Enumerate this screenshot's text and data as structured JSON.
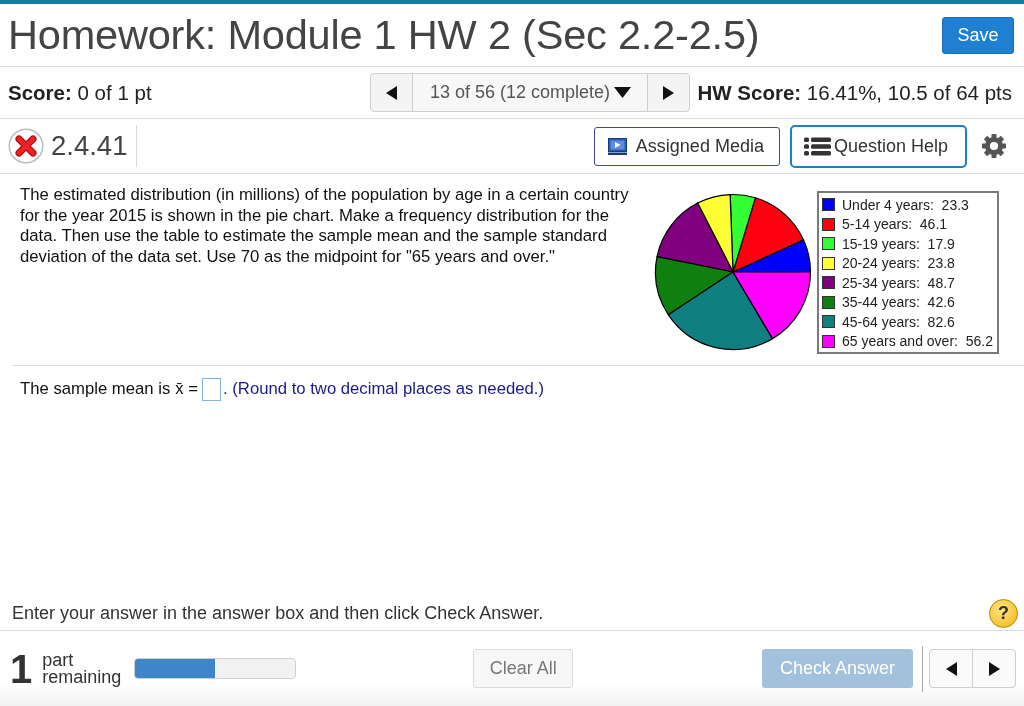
{
  "header": {
    "title": "Homework: Module 1 HW 2 (Sec 2.2-2.5)",
    "save_button": "Save"
  },
  "score_bar": {
    "score": "**Score:** 0 of 1 pt",
    "navigator": {
      "position": "13 of 56 (12 complete)"
    },
    "hw_score": "**HW Score:** 16.41%, 10.5 of 64 pts"
  },
  "question_bar": {
    "correct": false,
    "number": "2.4.41",
    "buttons": [
      {
        "kind": "media",
        "label": "Assigned Media",
        "focused": false
      },
      {
        "kind": "help",
        "label": "Question Help",
        "focused": true
      }
    ]
  },
  "question": {
    "text": "The estimated distribution (in millions) of the population by age in a certain country for the year 2015 is shown in the pie chart. Make a frequency distribution for the data. Then use the table to estimate the sample mean and the sample standard deviation of the data set. Use 70 as the midpoint for \"65 years and over.\"",
    "chart_data": [
      {
        "type": "pie",
        "categories": [
          "Under 4 years:  23.3",
          "5-14 years:  46.1",
          "15-19 years:  17.9",
          "20-24 years:  23.8",
          "25-34 years:  48.7",
          "35-44 years:  42.6",
          "45-64 years:  82.6",
          "65 years and over:  56.2"
        ],
        "values": [
          23.3,
          46.1,
          17.9,
          23.8,
          48.7,
          42.6,
          82.6,
          56.2
        ],
        "colors": [
          "#0000ff",
          "#ff0010",
          "#33ff33",
          "#ffff33",
          "#800080",
          "#0f7f0f",
          "#0f7f7f",
          "#ff00ff"
        ],
        "legend": "right"
      }
    ]
  },
  "answer": {
    "prefix": "The sample mean is",
    "symbol": "x̄ =",
    "hint": ". (Round to two decimal places as needed.)"
  },
  "instruction_bar": {
    "text": "Enter your answer in the answer box and then click Check Answer.",
    "help_button": "?"
  },
  "footer": {
    "parts_count": "1",
    "parts_label": "part remaining",
    "progress": {
      "level": 0.5
    },
    "clear_button": {
      "label": "Clear All"
    },
    "check_button": {
      "label": "Check Answer",
      "disabled": true
    }
  }
}
